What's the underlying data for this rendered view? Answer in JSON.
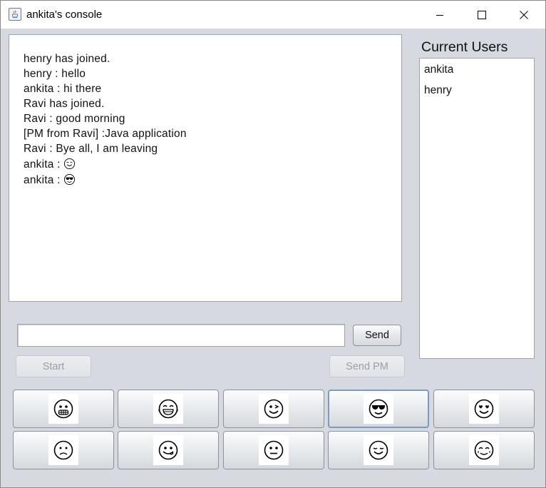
{
  "window": {
    "title": "ankita's console",
    "controls": [
      "minimize-icon",
      "maximize-icon",
      "close-icon"
    ]
  },
  "chat": {
    "lines": [
      {
        "text": "henry has joined."
      },
      {
        "text": "henry : hello"
      },
      {
        "text": "ankita : hi there"
      },
      {
        "text": "Ravi has joined."
      },
      {
        "text": "Ravi : good morning"
      },
      {
        "text": "[PM from Ravi] :Java application"
      },
      {
        "text": "Ravi : Bye all, I am leaving"
      },
      {
        "text": "ankita : ",
        "emoji": "smile-emoji-icon"
      },
      {
        "text": "ankita : ",
        "emoji": "sunglasses-emoji-icon"
      }
    ]
  },
  "users": {
    "label": "Current Users",
    "items": [
      "ankita",
      "henry"
    ]
  },
  "compose": {
    "input_value": "",
    "send_label": "Send",
    "start_label": "Start",
    "send_pm_label": "Send PM"
  },
  "emoji_panel": {
    "buttons": [
      {
        "icon": "grin-emoji-icon"
      },
      {
        "icon": "laughing-emoji-icon"
      },
      {
        "icon": "wink-emoji-icon"
      },
      {
        "icon": "sunglasses-emoji-icon",
        "focused": true
      },
      {
        "icon": "heart-eyes-emoji-icon"
      },
      {
        "icon": "sad-emoji-icon"
      },
      {
        "icon": "tongue-emoji-icon"
      },
      {
        "icon": "neutral-emoji-icon"
      },
      {
        "icon": "relieved-emoji-icon"
      },
      {
        "icon": "happy-tears-emoji-icon"
      }
    ]
  },
  "colors": {
    "window_bg": "#d6d9df",
    "focus_border": "#7e9bbd"
  }
}
